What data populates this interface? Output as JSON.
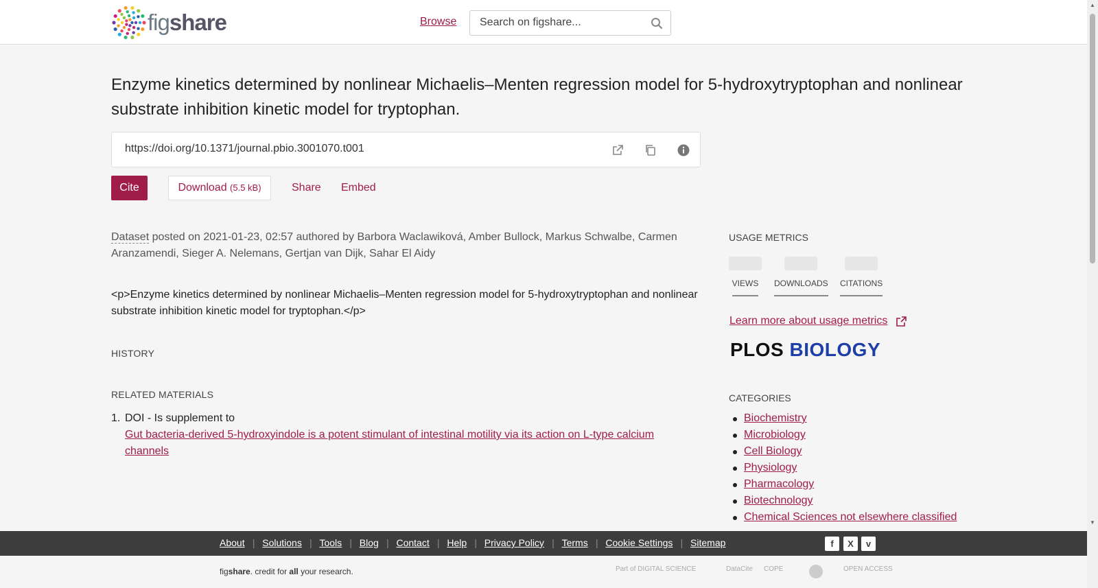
{
  "header": {
    "logo_text_light": "fig",
    "logo_text_bold": "share",
    "browse_label": "Browse",
    "search_placeholder": "Search on figshare..."
  },
  "article": {
    "title": "Enzyme kinetics determined by nonlinear Michaelis–Menten regression model for 5-hydroxytryptophan and nonlinear substrate inhibition kinetic model for tryptophan.",
    "doi": "https://doi.org/10.1371/journal.pbio.3001070.t001",
    "actions": {
      "cite": "Cite",
      "download": "Download",
      "download_size": "(5.5 kB)",
      "share": "Share",
      "embed": "Embed"
    },
    "item_type": "Dataset",
    "posted_text": " posted on 2021-01-23, 02:57 authored by Barbora Waclawiková, Amber Bullock, Markus Schwalbe, Carmen Aranzamendi, Sieger A. Nelemans, Gertjan van Dijk, Sahar El Aidy",
    "description": "<p>Enzyme kinetics determined by nonlinear Michaelis–Menten regression model for 5-hydroxytryptophan and nonlinear substrate inhibition kinetic model for tryptophan.</p>",
    "history_label": "HISTORY",
    "related_label": "RELATED MATERIALS",
    "related": {
      "num": "1.",
      "relation": "DOI - Is supplement to",
      "link": "Gut bacteria-derived 5-hydroxyindole is a potent stimulant of intestinal motility via its action on L-type calcium channels"
    }
  },
  "sidebar": {
    "usage_label": "USAGE METRICS",
    "metrics": [
      "VIEWS",
      "DOWNLOADS",
      "CITATIONS"
    ],
    "learn_more": "Learn more about usage metrics",
    "publisher_part1": "PLOS",
    "publisher_part2": "BIOLOGY",
    "categories_label": "CATEGORIES",
    "categories": [
      "Biochemistry",
      "Microbiology",
      "Cell Biology",
      "Physiology",
      "Pharmacology",
      "Biotechnology",
      "Chemical Sciences not elsewhere classified"
    ]
  },
  "footer": {
    "links": [
      "About",
      "Solutions",
      "Tools",
      "Blog",
      "Contact",
      "Help",
      "Privacy Policy",
      "Terms",
      "Cookie Settings",
      "Sitemap"
    ],
    "credit_fig": "fig",
    "credit_share": "share",
    "credit_mid": ". credit for ",
    "credit_all": "all",
    "credit_end": " your research.",
    "partners": [
      "Part of DIGITAL SCIENCE",
      "DataCite",
      "COPE",
      "",
      "OPEN ACCESS"
    ]
  },
  "colors": {
    "accent": "#a01c49",
    "footer_bg": "#3d3d3d",
    "page_bg": "#f5f5f5"
  }
}
